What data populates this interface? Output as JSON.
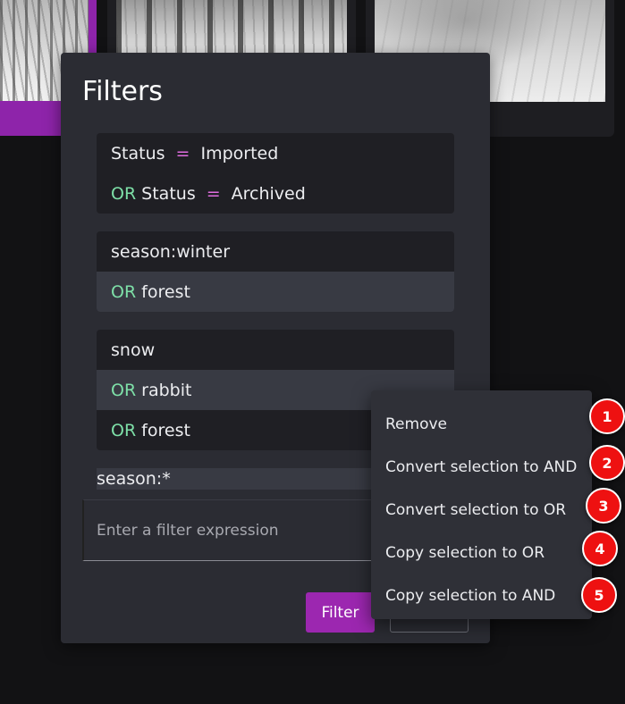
{
  "dialog": {
    "title": "Filters",
    "groups": [
      {
        "rows": [
          {
            "op": "",
            "field": "Status",
            "eq": "=",
            "value": "Imported"
          },
          {
            "op": "OR",
            "field": "Status",
            "eq": "=",
            "value": "Archived"
          }
        ]
      },
      {
        "rows": [
          {
            "op": "",
            "text": "season:winter"
          },
          {
            "op": "OR",
            "text": "forest",
            "selected": true
          }
        ]
      },
      {
        "rows": [
          {
            "op": "",
            "text": "snow"
          },
          {
            "op": "OR",
            "text": "rabbit",
            "selected": true
          },
          {
            "op": "OR",
            "text": "forest"
          }
        ]
      }
    ],
    "pending_expression": "season:*",
    "input_placeholder": "Enter a filter expression",
    "filter_button": "Filter"
  },
  "context_menu": {
    "items": [
      {
        "label": "Remove",
        "badge": "1"
      },
      {
        "label": "Convert selection to AND",
        "badge": "2"
      },
      {
        "label": "Convert selection to OR",
        "badge": "3"
      },
      {
        "label": "Copy selection to OR",
        "badge": "4"
      },
      {
        "label": "Copy selection to AND",
        "badge": "5"
      }
    ]
  },
  "colors": {
    "accent": "#9c27b0",
    "or_operator": "#7ee0a8",
    "equals_operator": "#e06ce0",
    "badge": "#ee1111"
  }
}
